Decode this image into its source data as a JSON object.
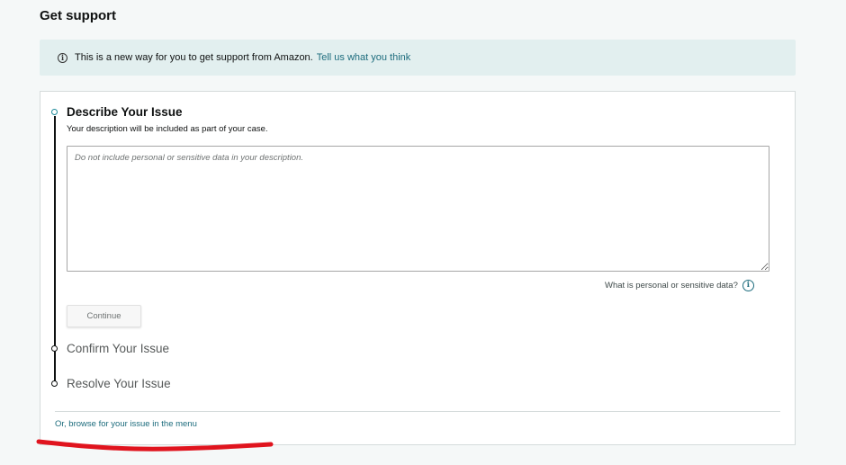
{
  "page": {
    "title": "Get support"
  },
  "banner": {
    "icon": "info-icon",
    "text": "This is a new way for you to get support from Amazon.",
    "link_label": "Tell us what you think"
  },
  "steps": {
    "describe": {
      "title": "Describe Your Issue",
      "description": "Your description will be included as part of your case.",
      "input_placeholder": "Do not include personal or sensitive data in your description.",
      "input_value": "",
      "help_link": "What is personal or sensitive data?",
      "help_icon": "info-icon",
      "continue_label": "Continue",
      "state": "active"
    },
    "confirm": {
      "title": "Confirm Your Issue",
      "state": "inactive"
    },
    "resolve": {
      "title": "Resolve Your Issue",
      "state": "inactive"
    }
  },
  "footer": {
    "browse_link": "Or, browse for your issue in the menu"
  },
  "colors": {
    "accent_link": "#1d6c7d",
    "active_step": "#1d8a99",
    "banner_bg": "#e2efef",
    "annotation_red": "#e0141e"
  }
}
